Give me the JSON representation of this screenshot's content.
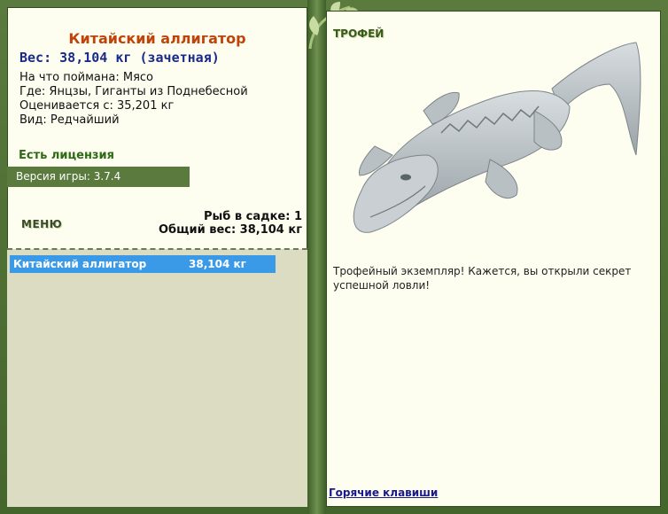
{
  "fish": {
    "title": "Китайский аллигатор",
    "weight": "Вес: 38,104 кг (зачетная)",
    "bait": "На что поймана: Мясо",
    "location": "Где: Янцзы, Гиганты из Поднебесной",
    "value": "Оценивается с: 35,201 кг",
    "rarity": "Вид: Редчайший"
  },
  "license": "Есть лицензия",
  "version": "Версия игры: 3.7.4",
  "menu_label": "МЕНЮ",
  "stats": {
    "fish_count": "Рыб в садке: 1",
    "total_weight": "Общий вес: 38,104 кг"
  },
  "catch_list": [
    {
      "name": "Китайский аллигатор",
      "weight": "38,104 кг"
    }
  ],
  "trophy": {
    "label": "ТРОФЕЙ",
    "text": "Трофейный экземпляр! Кажется, вы открыли секрет успешной ловли!"
  },
  "hotkeys_link": "Горячие клавиши",
  "colors": {
    "frame_green": "#5a7a3e",
    "panel_bg": "#fdfdf0",
    "title_orange": "#c0440a",
    "weight_blue": "#1a2a8a",
    "license_green": "#2d6a14",
    "selection_blue": "#3a9ae8"
  }
}
